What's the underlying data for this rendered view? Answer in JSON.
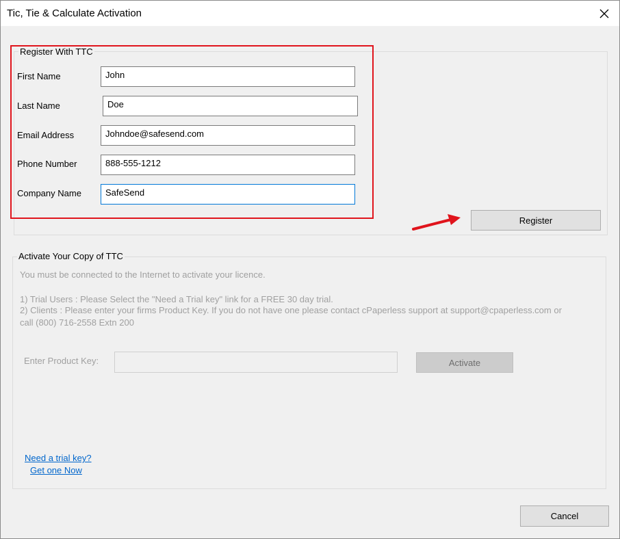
{
  "window": {
    "title": "Tic, Tie & Calculate Activation"
  },
  "register": {
    "legend": "Register With TTC",
    "fields": {
      "first_name": {
        "label": "First Name",
        "value": "John"
      },
      "last_name": {
        "label": "Last Name",
        "value": "Doe"
      },
      "email": {
        "label": "Email Address",
        "value": "Johndoe@safesend.com"
      },
      "phone": {
        "label": "Phone Number",
        "value": "888-555-1212"
      },
      "company": {
        "label": "Company Name",
        "value": "SafeSend"
      }
    },
    "register_button": "Register"
  },
  "activate": {
    "legend": "Activate Your Copy of TTC",
    "info_line1": "You must be connected to the Internet to activate your licence.",
    "info_line2": "1) Trial Users : Please Select the \"Need a Trial key\" link for a FREE 30 day trial.",
    "info_line3": "2) Clients : Please enter your firms Product Key. If you do not have one please contact cPaperless support at support@cpaperless.com or",
    "info_line4": "call (800) 716-2558 Extn 200",
    "product_key_label": "Enter Product Key:",
    "product_key_value": "",
    "activate_button": "Activate",
    "trial_link_1": "Need a trial key?",
    "trial_link_2": "Get one Now"
  },
  "footer": {
    "cancel_button": "Cancel"
  },
  "colors": {
    "highlight_frame": "#e0141c",
    "arrow": "#e0141c",
    "link": "#0066cc"
  }
}
